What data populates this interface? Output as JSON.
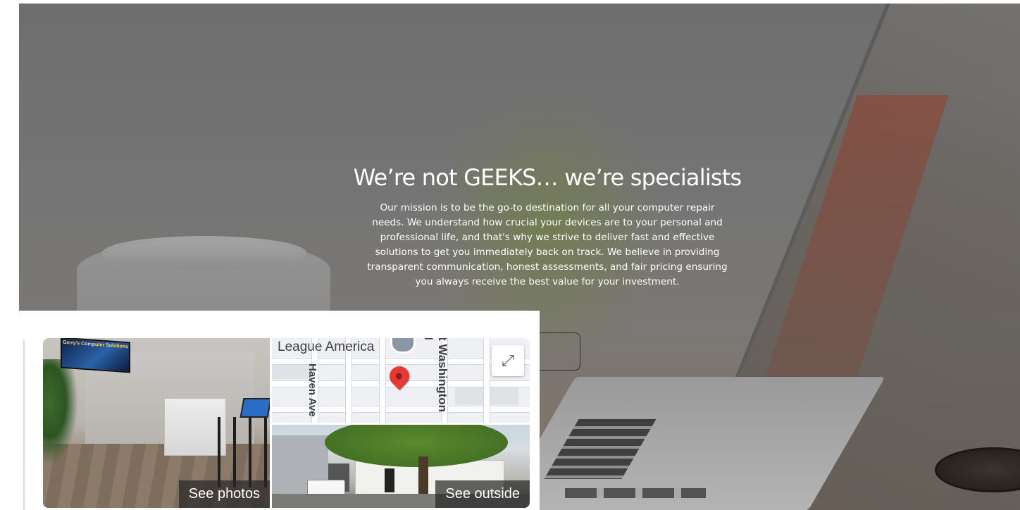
{
  "hero": {
    "title": "We’re not GEEKS… we’re specialists",
    "description": "Our mission is to be the go-to destination for all your computer repair needs. We understand how crucial your devices are to your personal and professional life, and that's why we strive to deliver fast and effective solutions to get you immediately back on track. We believe in providing transparent communication, honest assessments, and fair pricing ensuring you always receive the best value for your investment."
  },
  "maps_card": {
    "photos_label": "See photos",
    "outside_label": "See outside",
    "map": {
      "labels": [
        "League America",
        "Haven Ave",
        "t Washington I"
      ],
      "expand_icon": "expand-icon",
      "pin_icon": "location-pin-icon"
    },
    "tv_sign": "Gerry's Computer Solutions"
  },
  "colors": {
    "hero_overlay": "#747474",
    "pin": "#e53935",
    "label_bg": "#333333"
  }
}
